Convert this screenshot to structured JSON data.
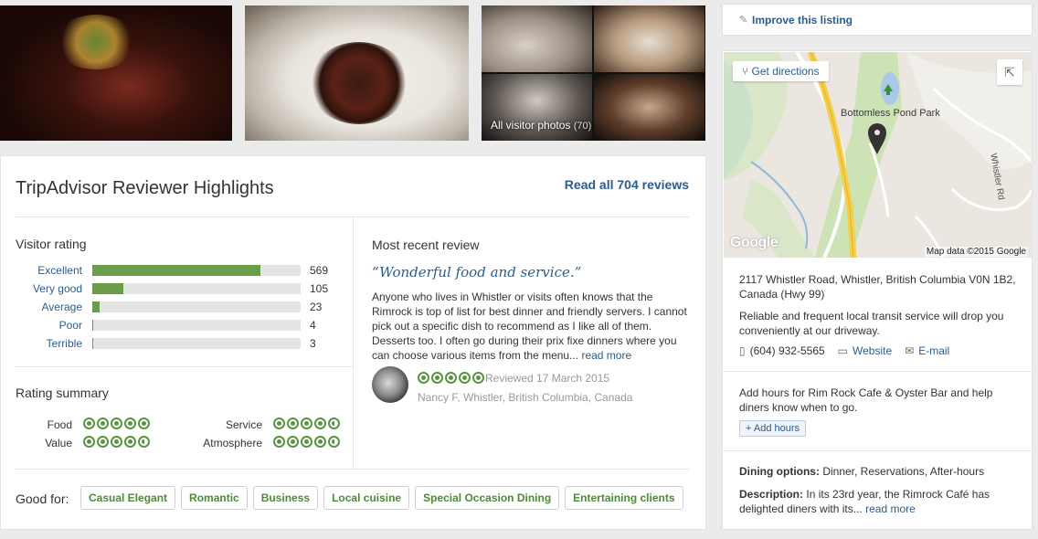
{
  "photos": {
    "all_visitor_photos_label": "All visitor photos",
    "count_label": "(70)"
  },
  "highlights": {
    "title": "TripAdvisor Reviewer Highlights",
    "read_all": "Read all 704 reviews",
    "visitor_rating_title": "Visitor rating",
    "ratings": [
      {
        "label": "Excellent",
        "count": "569",
        "fraction": 0.808
      },
      {
        "label": "Very good",
        "count": "105",
        "fraction": 0.149
      },
      {
        "label": "Average",
        "count": "23",
        "fraction": 0.033
      },
      {
        "label": "Poor",
        "count": "4",
        "fraction": 0.006
      },
      {
        "label": "Terrible",
        "count": "3",
        "fraction": 0.004
      }
    ],
    "rating_summary_title": "Rating summary",
    "summary": [
      {
        "label": "Food",
        "bubbles": 5
      },
      {
        "label": "Service",
        "bubbles": 4.5
      },
      {
        "label": "Value",
        "bubbles": 4.5
      },
      {
        "label": "Atmosphere",
        "bubbles": 4.5
      }
    ],
    "most_recent_title": "Most recent review",
    "review_title": "“Wonderful food and service.”",
    "review_text": "Anyone who lives in Whistler or visits often knows that the Rimrock is top of list for best dinner and friendly servers. I cannot pick out a specific dish to recommend as I like all of them. Desserts too. I often go during their prix fixe dinners where you can choose various items from the menu...",
    "read_more": "read more",
    "review_bubbles": 5,
    "reviewed_date": "Reviewed 17 March 2015",
    "reviewer": "Nancy F, Whistler, British Columbia, Canada",
    "good_for_label": "Good for:",
    "good_for": [
      "Casual Elegant",
      "Romantic",
      "Business",
      "Local cuisine",
      "Special Occasion Dining",
      "Entertaining clients"
    ]
  },
  "sidebar": {
    "improve_listing": "Improve this listing",
    "map": {
      "get_directions": "Get directions",
      "park_label": "Bottomless Pond Park",
      "road_label": "Whistler Rd",
      "google_logo": "Google",
      "map_data": "Map data ©2015 Google"
    },
    "address": "2117 Whistler Road, Whistler, British Columbia V0N 1B2, Canada (Hwy 99)",
    "transit": "Reliable and frequent local transit service will drop you conveniently at our driveway.",
    "phone": "(604) 932-5565",
    "website": "Website",
    "email": "E-mail",
    "hours_text": "Add hours for Rim Rock Cafe & Oyster Bar and help diners know when to go.",
    "add_hours": "+ Add hours",
    "dining_label": "Dining options:",
    "dining_value": "Dinner, Reservations, After-hours",
    "description_label": "Description:",
    "description_value": "In its 23rd year, the Rimrock Café has delighted diners with its...",
    "description_more": "read more"
  }
}
